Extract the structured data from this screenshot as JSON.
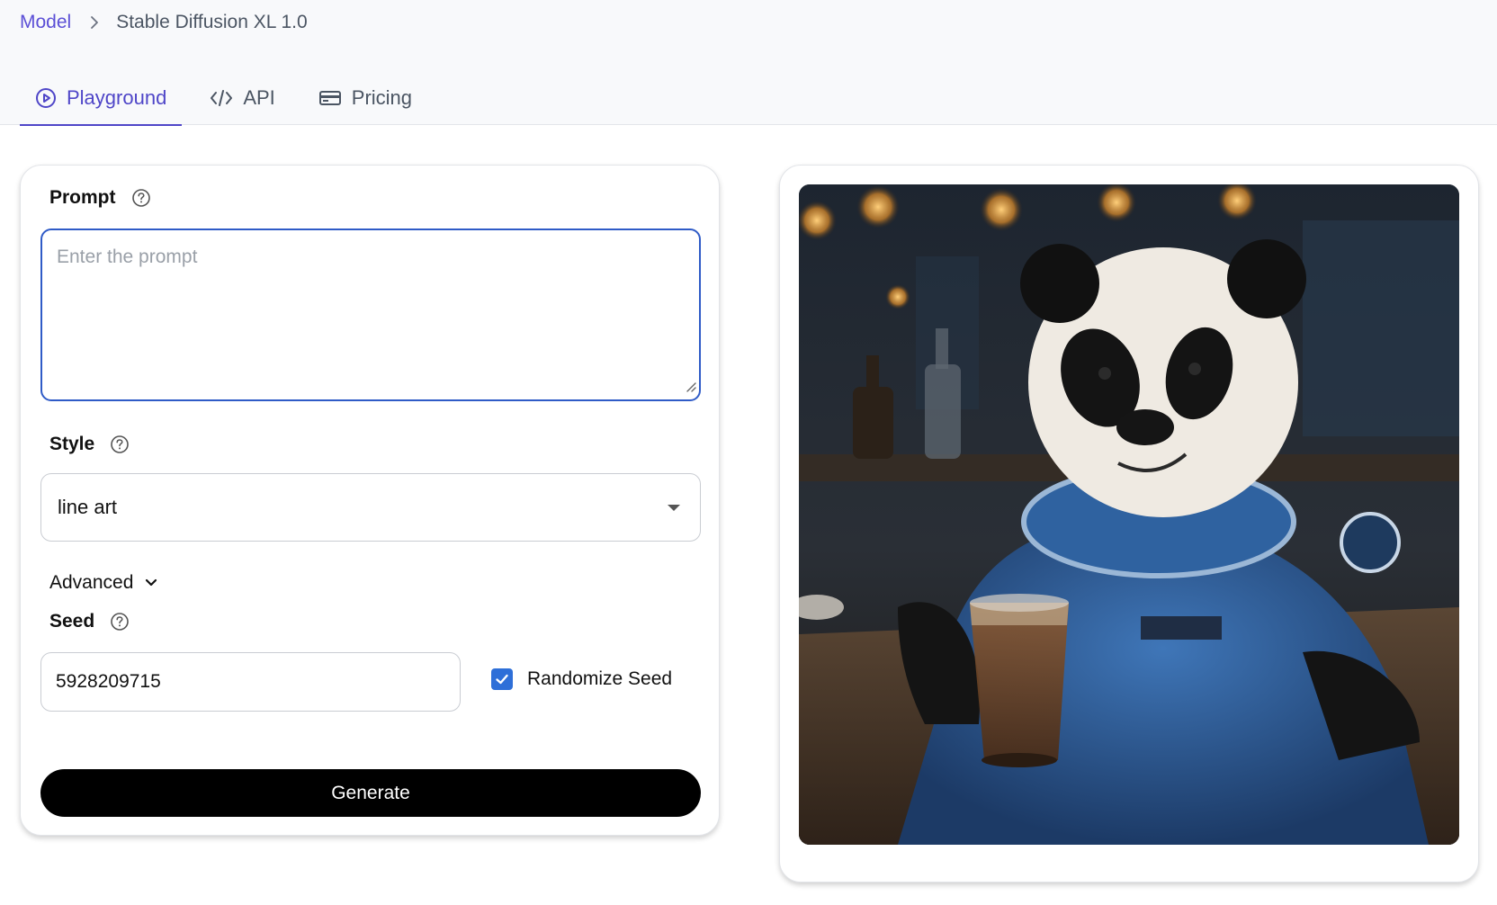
{
  "breadcrumb": {
    "parent": "Model",
    "current": "Stable Diffusion XL 1.0"
  },
  "tabs": [
    {
      "label": "Playground",
      "icon": "play-circle-icon",
      "active": true
    },
    {
      "label": "API",
      "icon": "code-icon",
      "active": false
    },
    {
      "label": "Pricing",
      "icon": "credit-card-icon",
      "active": false
    }
  ],
  "form": {
    "prompt_label": "Prompt",
    "prompt_placeholder": "Enter the prompt",
    "prompt_value": "",
    "style_label": "Style",
    "style_value": "line art",
    "advanced_label": "Advanced",
    "seed_label": "Seed",
    "seed_value": "5928209715",
    "randomize_label": "Randomize Seed",
    "randomize_checked": true,
    "generate_label": "Generate"
  },
  "colors": {
    "accent": "#4f46c8",
    "breadcrumb_link": "#5b4fd6",
    "focus_border": "#2f5bc7",
    "checkbox": "#2e6fd8",
    "button_bg": "#000000"
  }
}
